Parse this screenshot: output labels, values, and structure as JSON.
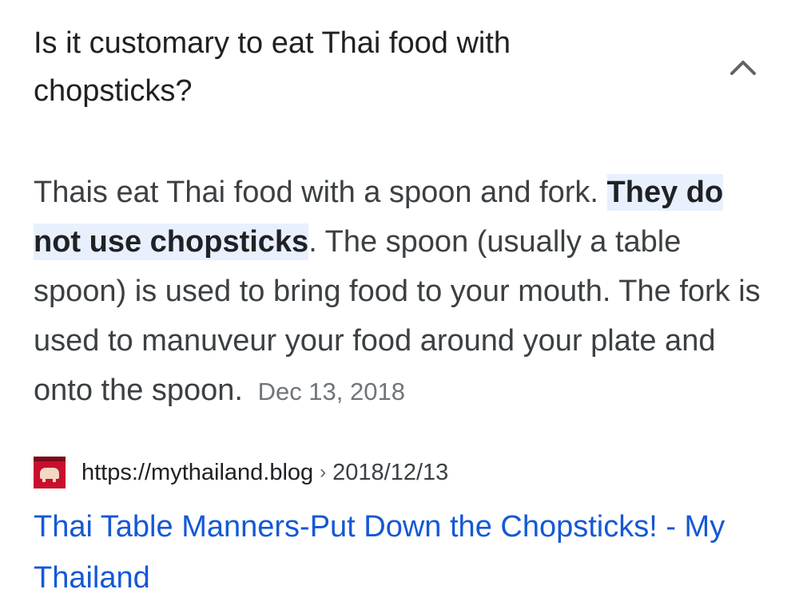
{
  "question": {
    "text": "Is it customary to eat Thai food with chopsticks?",
    "toggle_icon": "chevron-up-icon"
  },
  "answer": {
    "before_highlight": "Thais eat Thai food with a spoon and fork. ",
    "highlight": "They do not use chopsticks",
    "after_highlight": ". The spoon (usually a table spoon) is used to bring food to your mouth. The fork is used to manuveur your food around your plate and onto the spoon.",
    "date": "Dec 13, 2018"
  },
  "source": {
    "favicon_icon": "elephant-logo-icon",
    "url": "https://mythailand.blog",
    "separator": "›",
    "path": "2018/12/13"
  },
  "result": {
    "title": "Thai Table Manners-Put Down the Chopsticks! - My Thailand"
  },
  "colors": {
    "link": "#1558d6",
    "highlight_bg": "#e8f0fe",
    "text": "#3c4043",
    "secondary": "#70757a"
  }
}
